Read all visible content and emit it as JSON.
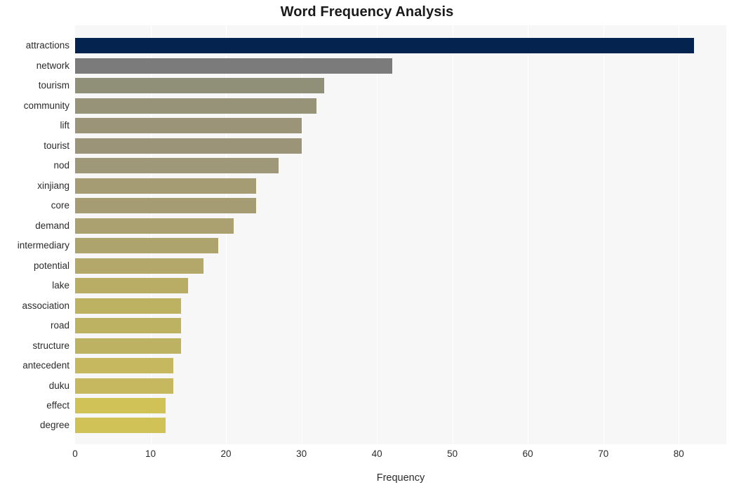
{
  "chart_data": {
    "type": "bar",
    "orientation": "horizontal",
    "title": "Word Frequency Analysis",
    "xlabel": "Frequency",
    "ylabel": "",
    "xlim": [
      0,
      86.3
    ],
    "xticks": [
      0,
      10,
      20,
      30,
      40,
      50,
      60,
      70,
      80
    ],
    "xtick_labels": [
      "0",
      "10",
      "20",
      "30",
      "40",
      "50",
      "60",
      "70",
      "80"
    ],
    "grid": "vertical",
    "legend": "none",
    "categories": [
      "attractions",
      "network",
      "tourism",
      "community",
      "lift",
      "tourist",
      "nod",
      "xinjiang",
      "core",
      "demand",
      "intermediary",
      "potential",
      "lake",
      "association",
      "road",
      "structure",
      "antecedent",
      "duku",
      "effect",
      "degree"
    ],
    "values": [
      82,
      42,
      33,
      32,
      30,
      30,
      27,
      24,
      24,
      21,
      19,
      17,
      15,
      14,
      14,
      14,
      13,
      13,
      12,
      12
    ],
    "bar_colors": [
      "#04244f",
      "#7b7b7b",
      "#908f78",
      "#969378",
      "#9b9478",
      "#9b9478",
      "#9f9878",
      "#a59c74",
      "#a59c74",
      "#aaa070",
      "#ada36d",
      "#b3a86a",
      "#b9ad66",
      "#bdb162",
      "#bdb162",
      "#bdb162",
      "#c5b85e",
      "#c5b85e",
      "#d0c257",
      "#d0c257"
    ],
    "plot_background": "#f7f7f7",
    "figure_background": "#ffffff",
    "gridline_color": "#ffffff"
  }
}
